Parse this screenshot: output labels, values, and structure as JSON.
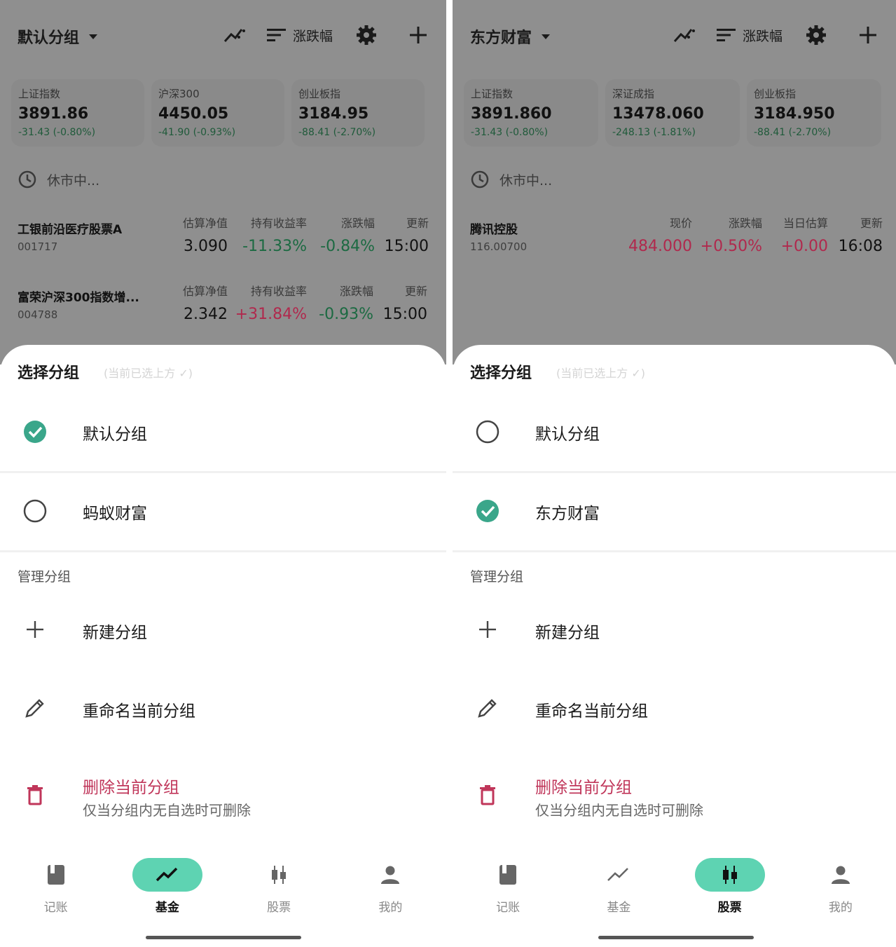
{
  "left": {
    "group_title": "默认分组",
    "sort_label": "涨跌幅",
    "indices": [
      {
        "name": "上证指数",
        "value": "3891.86",
        "change": "-31.43 (-0.80%)"
      },
      {
        "name": "沪深300",
        "value": "4450.05",
        "change": "-41.90 (-0.93%)"
      },
      {
        "name": "创业板指",
        "value": "3184.95",
        "change": "-88.41 (-2.70%)"
      }
    ],
    "status": "休市中...",
    "rows": [
      {
        "name": "工银前沿医疗股票A",
        "code": "001717",
        "cols": [
          {
            "header": "估算净值",
            "value": "3.090"
          },
          {
            "header": "持有收益率",
            "value": "-11.33%"
          },
          {
            "header": "涨跌幅",
            "value": "-0.84%"
          },
          {
            "header": "更新",
            "value": "15:00"
          }
        ]
      },
      {
        "name": "富荣沪深300指数增...",
        "code": "004788",
        "cols": [
          {
            "header": "估算净值",
            "value": "2.342"
          },
          {
            "header": "持有收益率",
            "value": "+31.84%"
          },
          {
            "header": "涨跌幅",
            "value": "-0.93%"
          },
          {
            "header": "更新",
            "value": "15:00"
          }
        ]
      }
    ],
    "sheet": {
      "title": "选择分组",
      "hint": "(当前已选上方 ✓)",
      "options": [
        {
          "label": "默认分组",
          "checked": true
        },
        {
          "label": "蚂蚁财富",
          "checked": false
        }
      ],
      "manage_label": "管理分组",
      "new_label": "新建分组",
      "rename_label": "重命名当前分组",
      "delete_label": "删除当前分组",
      "delete_sub": "仅当分组内无自选时可删除"
    },
    "nav": [
      {
        "label": "记账",
        "active": false
      },
      {
        "label": "基金",
        "active": true
      },
      {
        "label": "股票",
        "active": false
      },
      {
        "label": "我的",
        "active": false
      }
    ]
  },
  "right": {
    "group_title": "东方财富",
    "sort_label": "涨跌幅",
    "indices": [
      {
        "name": "上证指数",
        "value": "3891.860",
        "change": "-31.43 (-0.80%)"
      },
      {
        "name": "深证成指",
        "value": "13478.060",
        "change": "-248.13 (-1.81%)"
      },
      {
        "name": "创业板指",
        "value": "3184.950",
        "change": "-88.41 (-2.70%)"
      }
    ],
    "status": "休市中...",
    "rows": [
      {
        "name": "腾讯控股",
        "code": "116.00700",
        "cols": [
          {
            "header": "现价",
            "value": "484.000"
          },
          {
            "header": "涨跌幅",
            "value": "+0.50%"
          },
          {
            "header": "当日估算",
            "value": "+0.00"
          },
          {
            "header": "更新",
            "value": "16:08"
          }
        ]
      }
    ],
    "sheet": {
      "title": "选择分组",
      "hint": "(当前已选上方 ✓)",
      "options": [
        {
          "label": "默认分组",
          "checked": false
        },
        {
          "label": "东方财富",
          "checked": true
        }
      ],
      "manage_label": "管理分组",
      "new_label": "新建分组",
      "rename_label": "重命名当前分组",
      "delete_label": "删除当前分组",
      "delete_sub": "仅当分组内无自选时可删除"
    },
    "nav": [
      {
        "label": "记账",
        "active": false
      },
      {
        "label": "基金",
        "active": false
      },
      {
        "label": "股票",
        "active": true
      },
      {
        "label": "我的",
        "active": false
      }
    ]
  },
  "colors": {
    "accent": "#5ed3b2",
    "check": "#3aa68a",
    "negative": "#1c6a42",
    "positive": "#b0294d",
    "delete": "#c0365a"
  }
}
